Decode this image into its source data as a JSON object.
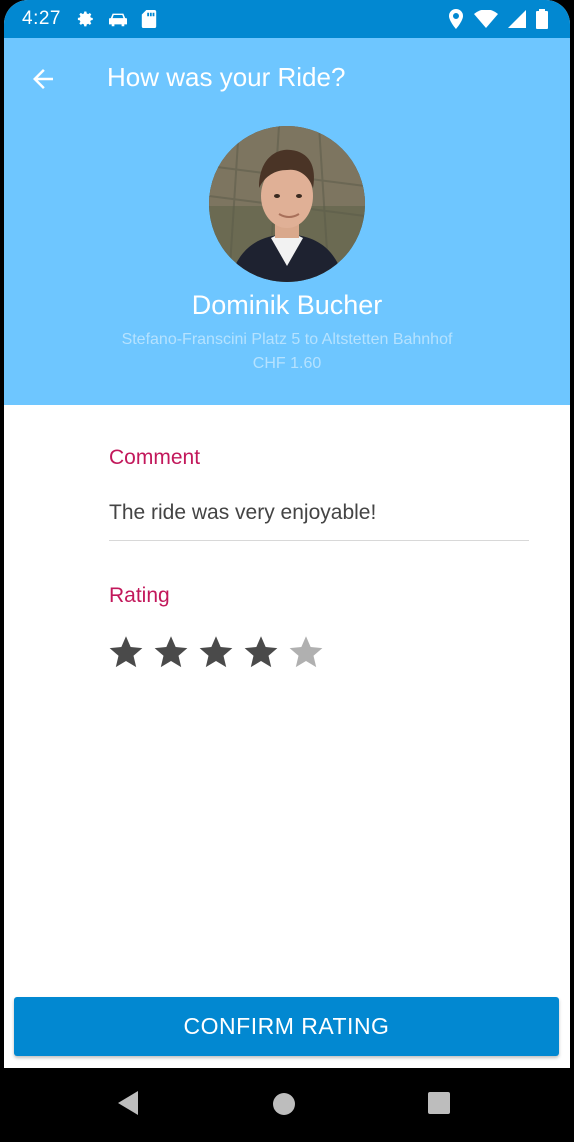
{
  "status_bar": {
    "time": "4:27",
    "left_icons": [
      "gear-icon",
      "car-icon",
      "sd-card-icon"
    ],
    "right_icons": [
      "location-pin-icon",
      "wifi-icon",
      "cell-signal-icon",
      "battery-icon"
    ]
  },
  "header": {
    "title": "How was your Ride?",
    "driver_name": "Dominik Bucher",
    "route": "Stefano-Franscini Platz 5 to Altstetten Bahnhof",
    "price": "CHF 1.60",
    "background_color": "#6ec6ff"
  },
  "form": {
    "comment_label": "Comment",
    "comment_value": "The ride was very enjoyable!",
    "rating_label": "Rating",
    "rating": 4,
    "rating_max": 5,
    "accent_color": "#c2185b"
  },
  "confirm_button": {
    "label": "CONFIRM RATING",
    "color": "#0288d1"
  },
  "nav_bar": {
    "icons": [
      "back-triangle-icon",
      "home-circle-icon",
      "recents-square-icon"
    ]
  }
}
